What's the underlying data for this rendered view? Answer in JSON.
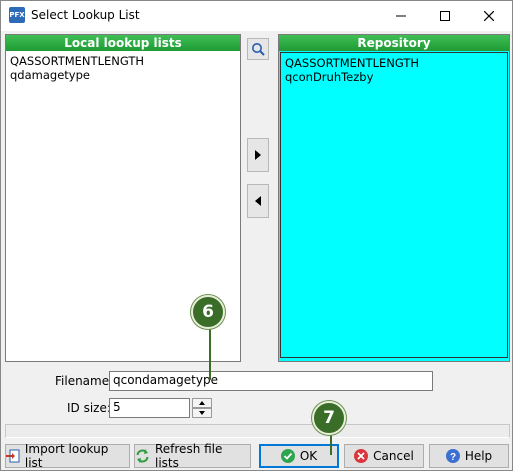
{
  "window": {
    "title": "Select Lookup List",
    "app_icon": "pfx-app-icon"
  },
  "local": {
    "header": "Local lookup lists",
    "items": [
      "QASSORTMENTLENGTH",
      "qdamagetype"
    ]
  },
  "repository": {
    "header": "Repository",
    "items": [
      "QASSORTMENTLENGTH",
      "qconDruhTezby"
    ],
    "background": "#00ffff"
  },
  "form": {
    "filename_label": "Filename:",
    "filename_value": "qcondamagetype",
    "idsize_label": "ID size:",
    "idsize_value": "5"
  },
  "buttons": {
    "import": "Import lookup list",
    "refresh": "Refresh file lists",
    "ok": "OK",
    "cancel": "Cancel",
    "help": "Help"
  },
  "callouts": [
    "6",
    "7"
  ],
  "colors": {
    "header_green": "#2aa845",
    "callout_green": "#3a6e28",
    "accent_blue": "#0078d7"
  }
}
